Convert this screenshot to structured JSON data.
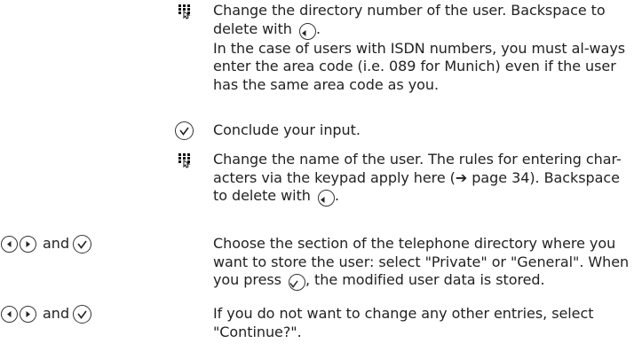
{
  "keypad_icon": "keypad-icon",
  "ok_icon": "check-circle-icon",
  "left_icon": "arrow-left-circle-icon",
  "right_icon": "arrow-right-circle-icon",
  "rows": [
    {
      "text1": "Change the directory number of the user. Backspace to delete with",
      "text1_end": ".",
      "text2": "In the case of users with ISDN numbers, you must al-ways enter the area code (i.e. 089 for Munich) even if the user has the same area code as you."
    },
    {
      "text1": "Conclude your input."
    },
    {
      "text1": "Change the name of the user. The rules for entering char-acters via the keypad apply here (➔ page 34). Backspace to delete with",
      "text1_end": "."
    },
    {
      "and_label": "and",
      "text1": "Choose the section of the telephone directory where you want to store the user: select \"Private\" or \"General\". When you press",
      "text1_end": ", the modified user data is stored."
    },
    {
      "and_label": "and",
      "text1": "If you do not want to change any other entries, select \"Continue?\"."
    }
  ]
}
